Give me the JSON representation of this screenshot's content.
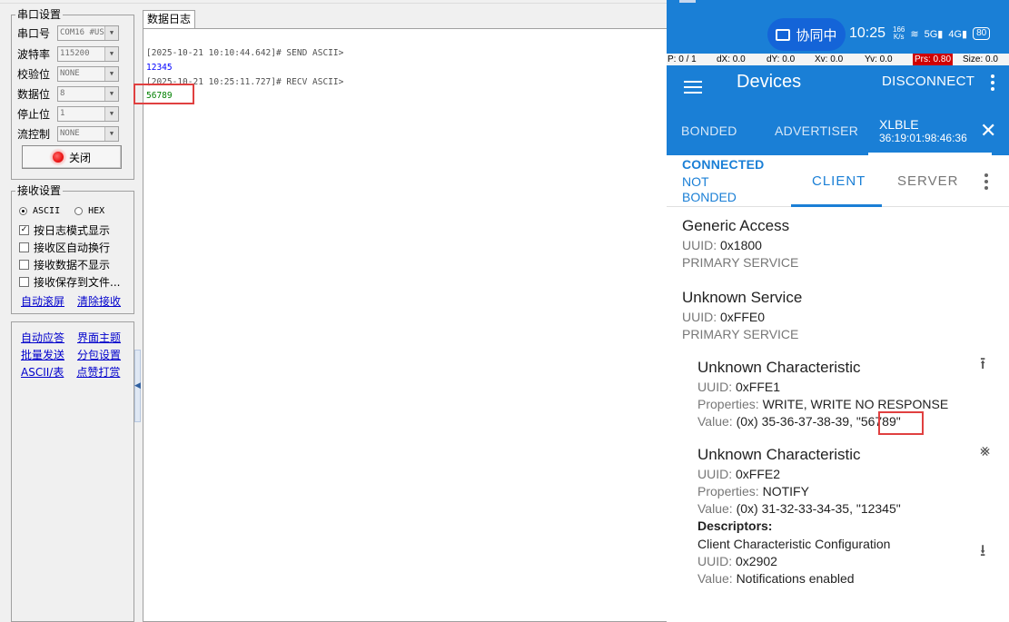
{
  "pc": {
    "serial_settings": {
      "title": "串口设置",
      "fields": [
        {
          "label": "串口号",
          "value": "COM16 #US"
        },
        {
          "label": "波特率",
          "value": "115200"
        },
        {
          "label": "校验位",
          "value": "NONE"
        },
        {
          "label": "数据位",
          "value": "8"
        },
        {
          "label": "停止位",
          "value": "1"
        },
        {
          "label": "流控制",
          "value": "NONE"
        }
      ],
      "close_button": "关闭"
    },
    "receive_settings": {
      "title": "接收设置",
      "mode_ascii": "ASCII",
      "mode_hex": "HEX",
      "options": [
        {
          "label": "按日志模式显示",
          "checked": true
        },
        {
          "label": "接收区自动换行",
          "checked": false
        },
        {
          "label": "接收数据不显示",
          "checked": false
        },
        {
          "label": "接收保存到文件...",
          "checked": false
        }
      ],
      "link_autoscroll": "自动滚屏",
      "link_clear": "清除接收"
    },
    "tools": {
      "links": [
        "自动应答",
        "界面主题",
        "批量发送",
        "分包设置",
        "ASCII/表",
        "点赞打赏"
      ]
    },
    "log": {
      "tab": "数据日志",
      "lines": [
        {
          "text": "[2025-10-21 10:10:44.642]# SEND ASCII>",
          "color": "#505050"
        },
        {
          "text": "12345",
          "color": "#0000ff"
        },
        {
          "text": "[2025-10-21 10:25:11.727]# RECV ASCII>",
          "color": "#505050"
        },
        {
          "text": "56789",
          "color": "#008000"
        }
      ]
    }
  },
  "phone": {
    "status": {
      "collab": "协同中",
      "time": "10:25",
      "net_speed_value": "166",
      "net_speed_unit": "K/s",
      "signal1": "5G",
      "signal2": "4G",
      "battery": "80"
    },
    "info_bar": {
      "p": "P: 0 / 1",
      "dx": "dX: 0.0",
      "dy": "dY: 0.0",
      "xv": "Xv: 0.0",
      "yv": "Yv: 0.0",
      "prs": "Prs: 0.80",
      "size": "Size: 0.0"
    },
    "appbar": {
      "title": "Devices",
      "disconnect": "DISCONNECT"
    },
    "tabs": {
      "bonded": "BONDED",
      "advertiser": "ADVERTISER",
      "device_name": "XLBLE",
      "device_addr": "36:19:01:98:46:36"
    },
    "subtabs": {
      "state": "CONNECTED",
      "bond": "NOT BONDED",
      "client": "CLIENT",
      "server": "SERVER"
    },
    "services": [
      {
        "title": "Generic Access",
        "uuid_label": "UUID:",
        "uuid": "0x1800",
        "type": "PRIMARY SERVICE"
      },
      {
        "title": "Unknown Service",
        "uuid_label": "UUID:",
        "uuid": "0xFFE0",
        "type": "PRIMARY SERVICE"
      }
    ],
    "characteristics": [
      {
        "title": "Unknown Characteristic",
        "uuid_label": "UUID:",
        "uuid": "0xFFE1",
        "props_label": "Properties:",
        "props": "WRITE, WRITE NO RESPONSE",
        "value_label": "Value:",
        "value": "(0x) 35-36-37-38-39, \"56789\""
      },
      {
        "title": "Unknown Characteristic",
        "uuid_label": "UUID:",
        "uuid": "0xFFE2",
        "props_label": "Properties:",
        "props": "NOTIFY",
        "value_label": "Value:",
        "value": "(0x) 31-32-33-34-35, \"12345\""
      }
    ],
    "descriptors": {
      "heading": "Descriptors:",
      "name": "Client Characteristic Configuration",
      "uuid_label": "UUID:",
      "uuid": "0x2902",
      "value_label": "Value:",
      "value": "Notifications enabled"
    },
    "colors": {
      "primary": "#1a7fd6",
      "highlight": "#e04040"
    }
  }
}
